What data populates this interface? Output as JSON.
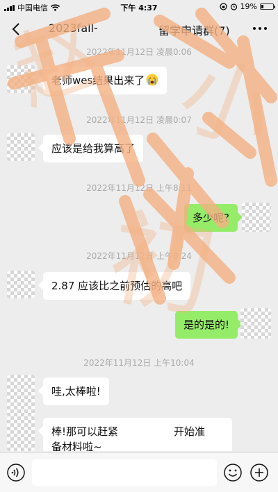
{
  "status": {
    "carrier": "中国电信",
    "time": "下午 4:37",
    "battery": "19%",
    "battery_level": 0.19
  },
  "nav": {
    "title_left": "2023fall-",
    "title_right": "留学申请群(7)"
  },
  "messages": [
    {
      "type": "timestamp",
      "text": "2022年11月12日 凌晨0:06"
    },
    {
      "type": "in",
      "text": "老师wes结果出来了",
      "emoji": "crying-face"
    },
    {
      "type": "timestamp",
      "text": "2022年11月12日 凌晨0:07"
    },
    {
      "type": "in",
      "text": "应该是给我算高了"
    },
    {
      "type": "timestamp",
      "text": "2022年11月12日 上午8:11"
    },
    {
      "type": "out",
      "text": "多少呢?"
    },
    {
      "type": "timestamp",
      "text": "2022年11月12日 上午8:24"
    },
    {
      "type": "in",
      "text": "2.87 应该比之前预估的高吧"
    },
    {
      "type": "out",
      "text": "是的是的!"
    },
    {
      "type": "timestamp",
      "text": "2022年11月12日 上午10:04"
    },
    {
      "type": "in",
      "text": "哇,太棒啦!"
    },
    {
      "type": "in",
      "text_part1": "棒!那可以赶紧",
      "text_part2": "开始准",
      "text_line2": "备材料啦~"
    }
  ],
  "watermark": {
    "text": [
      "赵",
      "小",
      "初"
    ],
    "color": "#f4b183"
  },
  "colors": {
    "outgoing_bubble": "#95ec69",
    "incoming_bubble": "#ffffff",
    "background": "#ededed"
  }
}
